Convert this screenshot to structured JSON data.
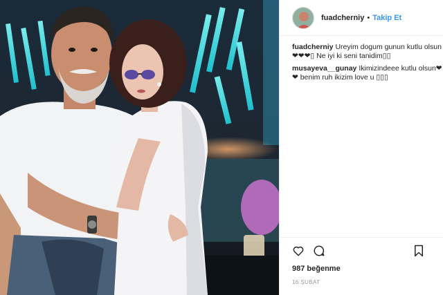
{
  "post": {
    "username": "fuadcherniy",
    "separator": "•",
    "follow_label": "Takip Et",
    "caption": {
      "username": "fuadcherniy",
      "text": "Ureyim dogum gunun kutlu olsun❤❤❤▯ Ne iyi ki seni tanidim▯▯"
    },
    "comments": [
      {
        "username": "musayeva__gunay",
        "text": "Ikimizindeee kutlu olsun❤❤ benim ruh ikizim love u ▯▯▯"
      }
    ],
    "likes_text": "987 beğenme",
    "date_text": "16 ŞUBAT"
  },
  "icons": {
    "like": "heart-icon",
    "comment": "comment-bubble-icon",
    "save": "bookmark-icon"
  },
  "colors": {
    "follow_link": "#3897f0",
    "neon": "#2ee6e6",
    "text": "#262626",
    "muted": "#999999"
  }
}
